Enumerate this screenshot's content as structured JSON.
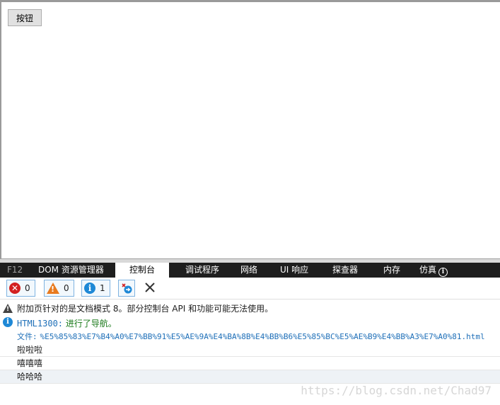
{
  "page": {
    "button_label": "按钮"
  },
  "devtools": {
    "tabs": [
      {
        "label": "F12"
      },
      {
        "label": "DOM 资源管理器"
      },
      {
        "label": "控制台"
      },
      {
        "label": "调试程序"
      },
      {
        "label": "网络"
      },
      {
        "label": "UI 响应"
      },
      {
        "label": "探查器"
      },
      {
        "label": "内存"
      },
      {
        "label": "仿真"
      }
    ],
    "active_tab": "控制台",
    "filters": {
      "errors": {
        "count": "0",
        "icon": "error-icon"
      },
      "warnings": {
        "count": "0",
        "icon": "warning-icon"
      },
      "messages": {
        "count": "1",
        "icon": "info-icon"
      }
    }
  },
  "console": {
    "messages": [
      {
        "type": "warning",
        "text": "附加页针对的是文档模式 8。部分控制台 API 和功能可能无法使用。"
      },
      {
        "type": "info",
        "code": "HTML1300:",
        "text": "进行了导航。"
      }
    ],
    "file_label": "文件:",
    "file_link": "%E5%85%83%E7%B4%A0%E7%BB%91%E5%AE%9A%E4%BA%8B%E4%BB%B6%E5%85%BC%E5%AE%B9%E4%BB%A3%E7%A0%81.html",
    "logs": [
      "啦啦啦",
      "嘻嘻嘻",
      "哈哈哈"
    ]
  },
  "watermark": "https://blog.csdn.net/Chad97",
  "colors": {
    "tabbar_bg": "#1e1e1e",
    "error": "#d32020",
    "warning": "#e87a1e",
    "info": "#1e88d6",
    "link": "#1e6fb8",
    "success": "#1a7a1a"
  }
}
